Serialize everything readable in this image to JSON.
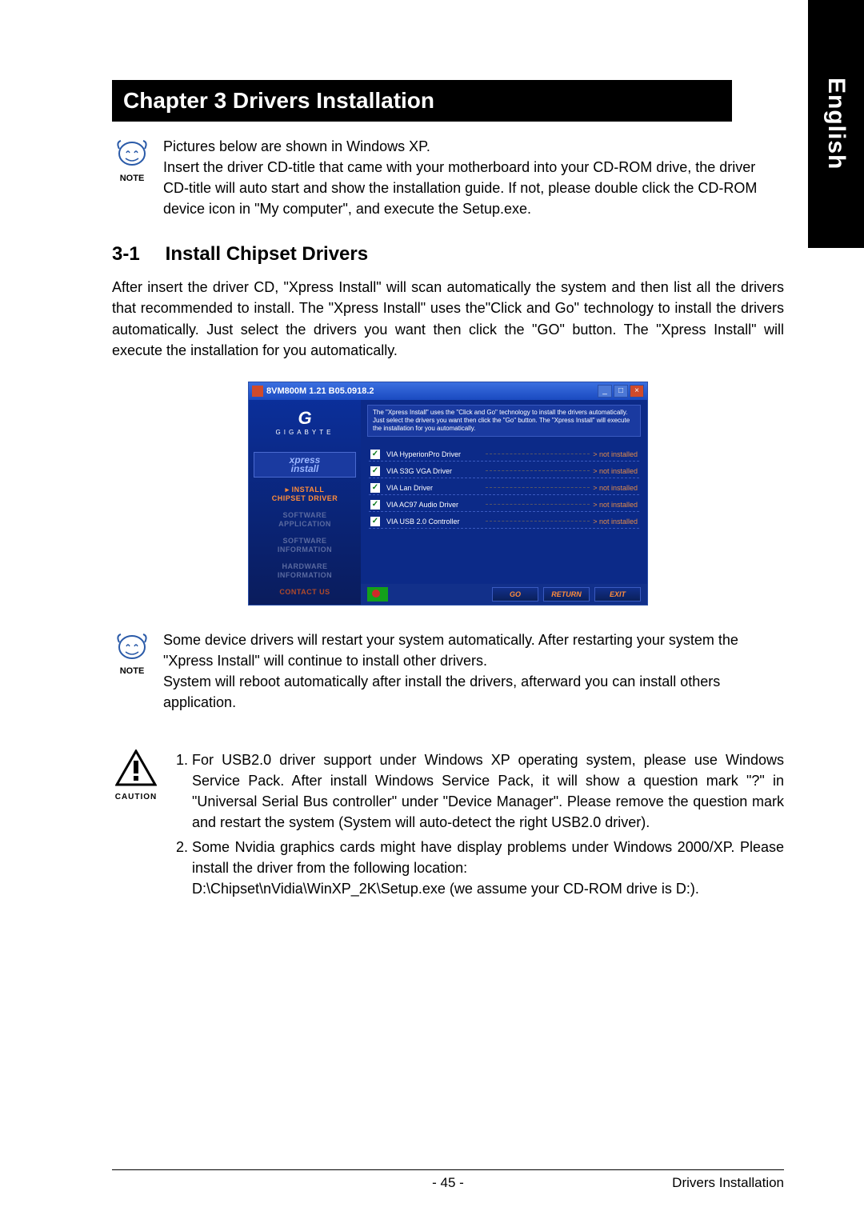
{
  "side_tab": "English",
  "chapter_title": "Chapter 3 Drivers Installation",
  "note1": {
    "label": "NOTE",
    "text": "Pictures below are shown in Windows XP.\nInsert the driver CD-title that came with your motherboard into your CD-ROM drive, the driver CD-title will auto start and show the installation guide. If not, please double click the CD-ROM device icon in \"My computer\", and execute the Setup.exe."
  },
  "section": {
    "num": "3-1",
    "title": "Install Chipset Drivers"
  },
  "body1": "After insert the driver CD, \"Xpress Install\" will  scan automatically the system and then list all the drivers that recommended to install. The \"Xpress Install\" uses the\"Click and Go\" technology to install the drivers automatically. Just select the drivers you want then click the \"GO\" button. The \"Xpress Install\" will execute the installation for you automatically.",
  "app": {
    "title": "8VM800M 1.21 B05.0918.2",
    "win_min": "_",
    "win_max": "□",
    "win_close": "×",
    "brand": "G",
    "brand_sub": "GIGABYTE",
    "xpress_l1": "xpress",
    "xpress_l2": "install",
    "side_items": [
      {
        "l1": "▸ INSTALL",
        "l2": "CHIPSET DRIVER",
        "cls": "active"
      },
      {
        "l1": "SOFTWARE",
        "l2": "APPLICATION",
        "cls": "dim"
      },
      {
        "l1": "SOFTWARE",
        "l2": "INFORMATION",
        "cls": "dim"
      },
      {
        "l1": "HARDWARE",
        "l2": "INFORMATION",
        "cls": "dim"
      },
      {
        "l1": "CONTACT US",
        "l2": "",
        "cls": ""
      }
    ],
    "info_text": "The \"Xpress Install\" uses the \"Click and Go\" technology to install the drivers automatically. Just select the drivers you want then click the \"Go\" button. The \"Xpress Install\" will execute the installation for you automatically.",
    "drivers": [
      {
        "name": "VIA HyperionPro Driver",
        "status": "not installed"
      },
      {
        "name": "VIA S3G VGA Driver",
        "status": "not installed"
      },
      {
        "name": "VIA Lan Driver",
        "status": "not installed"
      },
      {
        "name": "VIA AC97 Audio Driver",
        "status": "not installed"
      },
      {
        "name": "VIA USB 2.0 Controller",
        "status": "not installed"
      }
    ],
    "buttons": {
      "go": "GO",
      "return": "RETURN",
      "exit": "EXIT"
    }
  },
  "note2": {
    "label": "NOTE",
    "p1": "Some device drivers will restart your system automatically. After restarting your system the \"Xpress Install\" will continue to install other drivers.",
    "p2": "System will reboot automatically after install the drivers, afterward you can install others application."
  },
  "caution": {
    "label": "CAUTION",
    "items": [
      "For USB2.0 driver support under Windows XP operating system, please use Windows Service Pack. After install Windows Service Pack, it will show a question mark \"?\" in \"Universal Serial Bus controller\" under \"Device Manager\". Please remove the question mark and restart the system (System will auto-detect the right USB2.0 driver).",
      "Some Nvidia graphics cards might have display problems under Windows 2000/XP. Please install the driver from the following location:"
    ],
    "location": "D:\\Chipset\\nVidia\\WinXP_2K\\Setup.exe (we assume your CD-ROM drive is D:)."
  },
  "footer": {
    "page": "- 45 -",
    "section": "Drivers Installation"
  }
}
